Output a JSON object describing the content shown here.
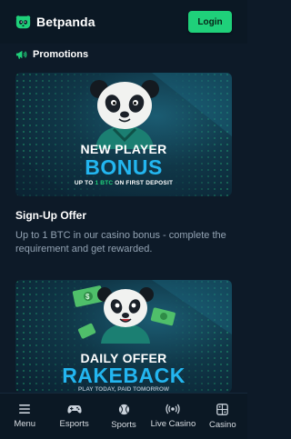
{
  "header": {
    "brand_name": "Betpanda",
    "login_label": "Login",
    "logo_icon": "panda-logo-icon",
    "accent_color": "#1fd07a"
  },
  "section": {
    "title": "Promotions",
    "icon": "megaphone-icon"
  },
  "promos": [
    {
      "banner_line1": "NEW PLAYER",
      "banner_line2": "BONUS",
      "banner_sub_prefix": "UP TO ",
      "banner_sub_highlight": "1 BTC",
      "banner_sub_suffix": " ON FIRST DEPOSIT",
      "title": "Sign-Up Offer",
      "description": "Up to 1 BTC in our casino bonus - complete the requirement and get rewarded."
    },
    {
      "banner_line1": "DAILY OFFER",
      "banner_line2": "RAKEBACK",
      "banner_sub": "PLAY TODAY, PAID TOMORROW"
    }
  ],
  "bottom_nav": [
    {
      "label": "Menu",
      "icon": "hamburger-menu-icon"
    },
    {
      "label": "Esports",
      "icon": "gamepad-icon"
    },
    {
      "label": "Sports",
      "icon": "ball-icon"
    },
    {
      "label": "Live Casino",
      "icon": "live-broadcast-icon"
    },
    {
      "label": "Casino",
      "icon": "dice-icon"
    }
  ]
}
